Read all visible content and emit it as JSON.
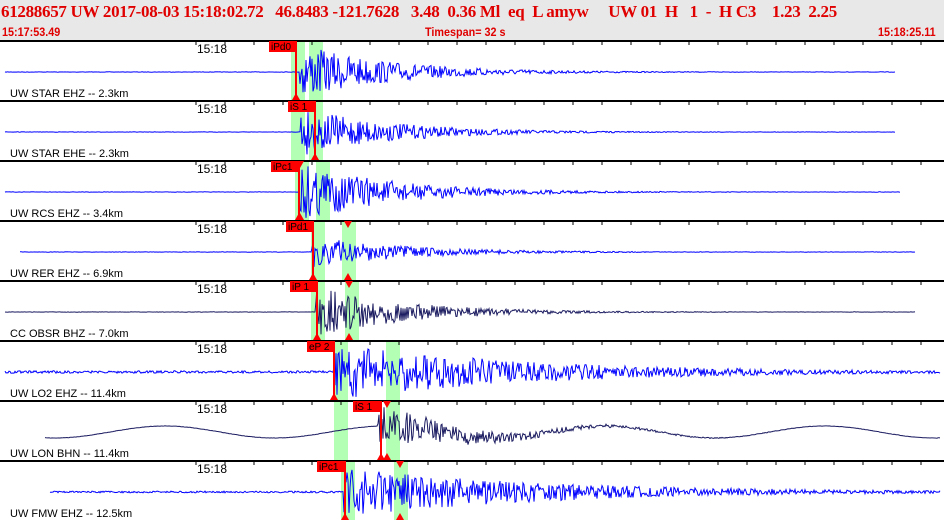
{
  "header": {
    "title": "61288657 UW 2017-08-03 15:18:02.72   46.8483 -121.7628   3.48  0.36 Ml  eq  L amyw     UW 01  H   1  -  H C3    1.23  2.25",
    "start_time": "15:17:53.49",
    "timespan": "Timespan=  32 s",
    "end_time": "15:18:25.11"
  },
  "colors": {
    "trace_blue": "#0000ff",
    "trace_navy": "#1a1a60",
    "pick": "#ff0000",
    "window": "#b3ffb3"
  },
  "tick_label": "15:18",
  "panels": [
    {
      "station": "UW STAR EHZ -- 2.3km",
      "pick": "iPd0",
      "color": "blue",
      "p": 296,
      "s": null,
      "labx": 269,
      "g": [
        291,
        309
      ],
      "tr": [
        5,
        895
      ],
      "amp": 1.0,
      "on": 300
    },
    {
      "station": "UW STAR EHE -- 2.3km",
      "pick": "iS 1",
      "color": "blue",
      "p": 315,
      "s": null,
      "labx": 288,
      "g": [
        291,
        309
      ],
      "tr": [
        5,
        895
      ],
      "amp": 0.9,
      "on": 300
    },
    {
      "station": "UW RCS EHZ -- 3.4km",
      "pick": "iPc1",
      "color": "blue",
      "p": 299,
      "s": 300,
      "labx": 271,
      "g": [
        295,
        316
      ],
      "tr": [
        5,
        900
      ],
      "amp": 1.1,
      "on": 300
    },
    {
      "station": "UW RER EHZ -- 6.9km",
      "pick": "iPd1",
      "color": "blue",
      "p": 313,
      "s": 348,
      "labx": 286,
      "g": [
        311,
        342
      ],
      "tr": [
        20,
        915
      ],
      "amp": 0.6,
      "on": 312
    },
    {
      "station": "CC OBSR BHZ -- 7.0km",
      "pick": "iP 1",
      "color": "navy",
      "p": 317,
      "s": 349,
      "labx": 290,
      "g": [
        311,
        345
      ],
      "tr": [
        5,
        915
      ],
      "amp": 0.9,
      "on": 316
    },
    {
      "station": "UW LO2 EHZ -- 11.4km",
      "pick": "eP 2",
      "color": "blue",
      "p": 334,
      "s": null,
      "labx": 307,
      "g": [
        334,
        386
      ],
      "tr": [
        5,
        940
      ],
      "amp": 1.0,
      "on": 334,
      "noise": 0.4
    },
    {
      "station": "UW LON BHN -- 11.4km",
      "pick": "iS 1",
      "color": "navy",
      "p": 381,
      "s": 387,
      "labx": 353,
      "g": [
        334,
        386
      ],
      "tr": [
        45,
        940
      ],
      "amp": 0.8,
      "on": 378,
      "wave": 1
    },
    {
      "station": "UW FMW EHZ -- 12.5km",
      "pick": "iPc1",
      "color": "blue",
      "p": 345,
      "s": 400,
      "labx": 317,
      "g": [
        341,
        394
      ],
      "tr": [
        50,
        940
      ],
      "amp": 0.9,
      "on": 344,
      "noise": 0.3
    }
  ]
}
